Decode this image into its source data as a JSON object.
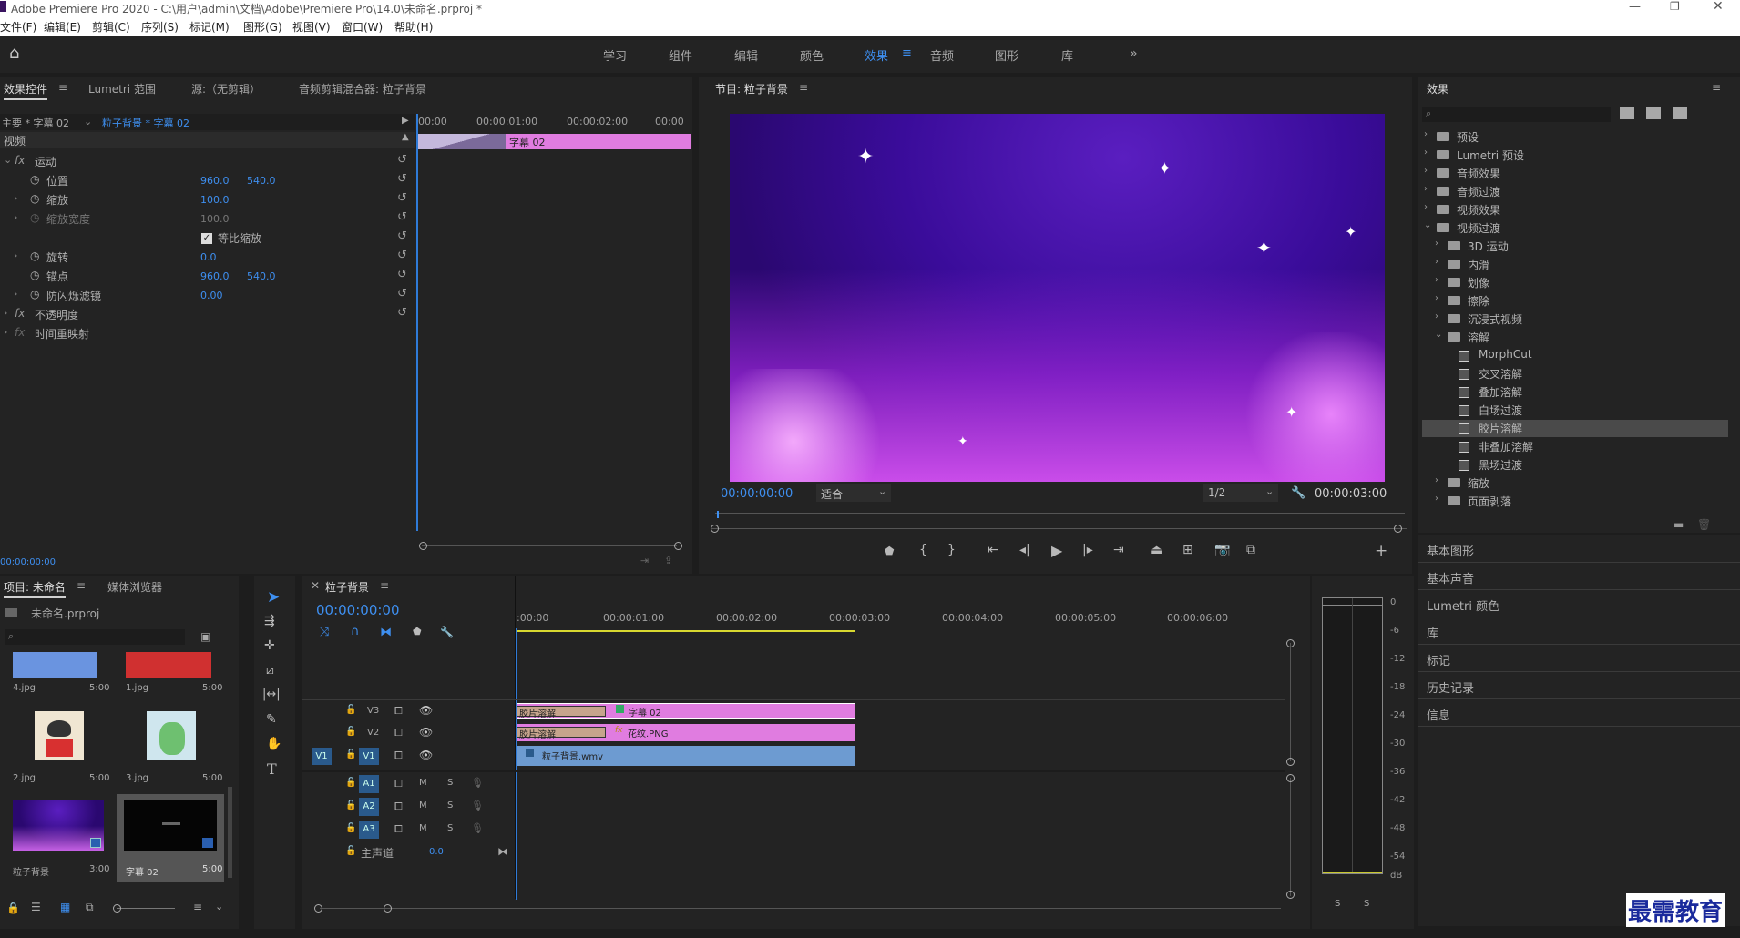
{
  "titlebar": {
    "title": "Adobe Premiere Pro 2020 - C:\\用户\\admin\\文档\\Adobe\\Premiere Pro\\14.0\\未命名.prproj *"
  },
  "menu": [
    "文件(F)",
    "编辑(E)",
    "剪辑(C)",
    "序列(S)",
    "标记(M)",
    "图形(G)",
    "视图(V)",
    "窗口(W)",
    "帮助(H)"
  ],
  "workspaces": [
    "学习",
    "组件",
    "编辑",
    "颜色",
    "效果",
    "音频",
    "图形",
    "库"
  ],
  "workspace_active": "效果",
  "effect_controls": {
    "tabs": [
      "效果控件",
      "Lumetri 范围",
      "源:（无剪辑）",
      "音频剪辑混合器: 粒子背景"
    ],
    "clip_path_master": "主要 * 字幕 02",
    "clip_path_seq": "粒子背景 * 字幕 02",
    "ruler": [
      "00:00",
      "00:00:01:00",
      "00:00:02:00",
      "00:00"
    ],
    "clip_label": "字幕 02",
    "section": "视频",
    "motion": "运动",
    "position": "位置",
    "position_x": "960.0",
    "position_y": "540.0",
    "scale": "缩放",
    "scale_val": "100.0",
    "scale_width": "缩放宽度",
    "scale_width_val": "100.0",
    "uniform": "等比缩放",
    "rotation": "旋转",
    "rotation_val": "0.0",
    "anchor": "锚点",
    "anchor_x": "960.0",
    "anchor_y": "540.0",
    "flicker": "防闪烁滤镜",
    "flicker_val": "0.00",
    "opacity": "不透明度",
    "time_remap": "时间重映射",
    "timecode": "00:00:00:00"
  },
  "program": {
    "title": "节目: 粒子背景",
    "timecode": "00:00:00:00",
    "fit": "适合",
    "resolution": "1/2",
    "duration": "00:00:03:00"
  },
  "effects_panel": {
    "title": "效果",
    "tree": [
      {
        "label": "预设",
        "level": 0
      },
      {
        "label": "Lumetri 预设",
        "level": 0
      },
      {
        "label": "音频效果",
        "level": 0
      },
      {
        "label": "音频过渡",
        "level": 0
      },
      {
        "label": "视频效果",
        "level": 0
      },
      {
        "label": "视频过渡",
        "level": 0,
        "open": true
      },
      {
        "label": "3D 运动",
        "level": 1
      },
      {
        "label": "内滑",
        "level": 1
      },
      {
        "label": "划像",
        "level": 1
      },
      {
        "label": "擦除",
        "level": 1
      },
      {
        "label": "沉浸式视频",
        "level": 1
      },
      {
        "label": "溶解",
        "level": 1,
        "open": true
      },
      {
        "label": "MorphCut",
        "level": 2
      },
      {
        "label": "交叉溶解",
        "level": 2
      },
      {
        "label": "叠加溶解",
        "level": 2
      },
      {
        "label": "白场过渡",
        "level": 2
      },
      {
        "label": "胶片溶解",
        "level": 2,
        "selected": true
      },
      {
        "label": "非叠加溶解",
        "level": 2
      },
      {
        "label": "黑场过渡",
        "level": 2
      },
      {
        "label": "缩放",
        "level": 1
      },
      {
        "label": "页面剥落",
        "level": 1
      }
    ],
    "side_panels": [
      "基本图形",
      "基本声音",
      "Lumetri 颜色",
      "库",
      "标记",
      "历史记录",
      "信息"
    ]
  },
  "project": {
    "tabs": [
      "项目: 未命名",
      "媒体浏览器"
    ],
    "file": "未命名.prproj",
    "items": [
      {
        "name": "4.jpg",
        "dur": "5:00"
      },
      {
        "name": "1.jpg",
        "dur": "5:00"
      },
      {
        "name": "2.jpg",
        "dur": "5:00"
      },
      {
        "name": "3.jpg",
        "dur": "5:00"
      },
      {
        "name": "粒子背景",
        "dur": "3:00"
      },
      {
        "name": "字幕 02",
        "dur": "5:00"
      }
    ]
  },
  "timeline": {
    "title": "粒子背景",
    "timecode": "00:00:00:00",
    "ruler": [
      ":00:00",
      "00:00:01:00",
      "00:00:02:00",
      "00:00:03:00",
      "00:00:04:00",
      "00:00:05:00",
      "00:00:06:00"
    ],
    "video_tracks": [
      "V3",
      "V2",
      "V1"
    ],
    "audio_tracks": [
      "A1",
      "A2",
      "A3"
    ],
    "source_patch": "V1",
    "master": "主声道",
    "master_val": "0.0",
    "clips": {
      "v3_transition": "胶片溶解",
      "v3_clip": "字幕 02",
      "v2_transition": "胶片溶解",
      "v2_clip": "花纹.PNG",
      "v1_clip": "粒子背景.wmv"
    }
  },
  "meter_scale": [
    "0",
    "-6",
    "-12",
    "-18",
    "-24",
    "-30",
    "-36",
    "-42",
    "-48",
    "-54",
    "dB"
  ],
  "meter_solo": [
    "S",
    "S"
  ],
  "watermark": "最需教育"
}
